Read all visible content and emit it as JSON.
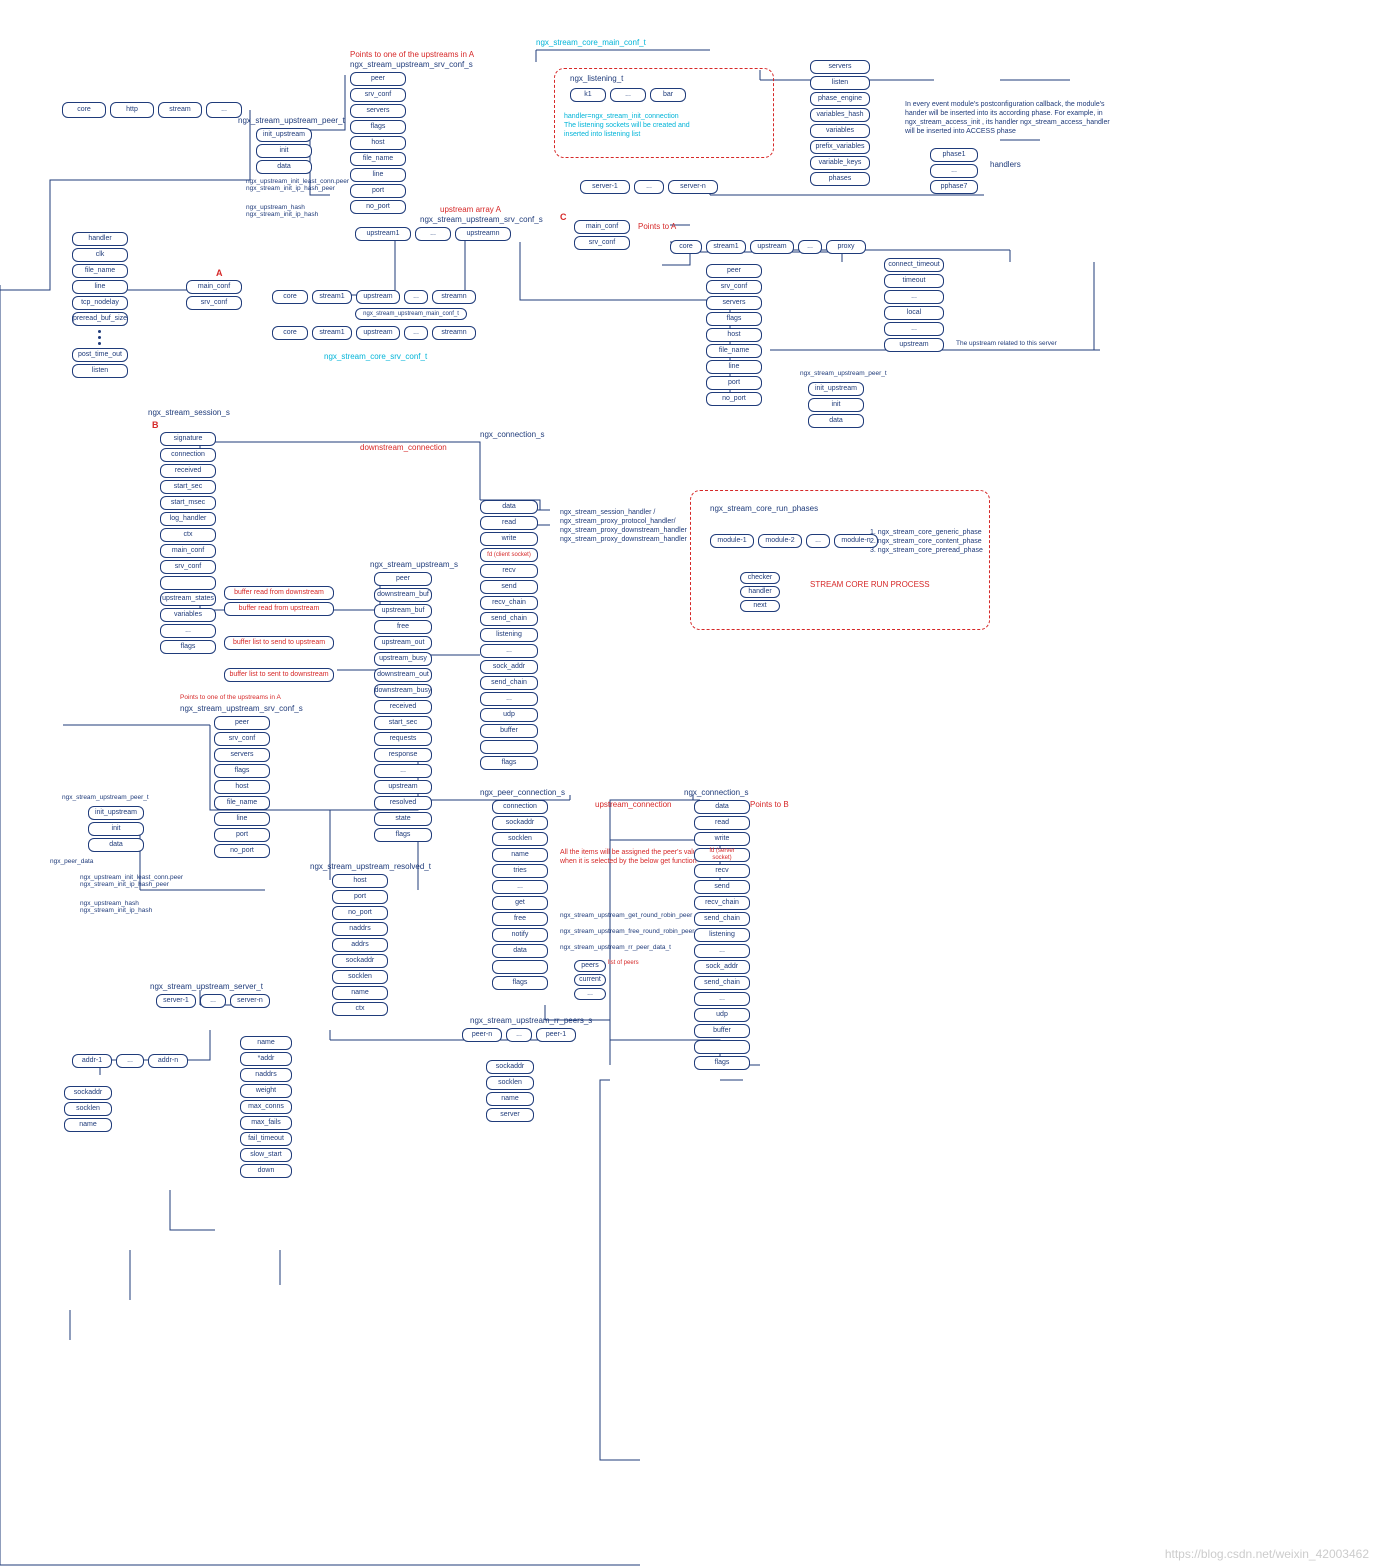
{
  "top_row": {
    "items": [
      "core",
      "http",
      "stream",
      "..."
    ]
  },
  "peer_t_1": {
    "title": "ngx_stream_upstream_peer_t",
    "items": [
      "init_upstream",
      "init",
      "data"
    ],
    "handlers_a": "ngx_upstream_init_least_conn.peer\nngx_stream_init_ip_hash_peer",
    "handlers_b": "ngx_upstream_hash\nngx_stream_init_ip_hash"
  },
  "upstream_srv_conf_1": {
    "red": "Points to one of the upstreams in A",
    "title": "ngx_stream_upstream_srv_conf_s",
    "items": [
      "peer",
      "srv_conf",
      "servers",
      "flags",
      "host",
      "file_name",
      "line",
      "port",
      "no_port"
    ]
  },
  "upstream_array": {
    "red": "upstream array A",
    "title": "ngx_stream_upstream_srv_conf_s",
    "items": [
      "upstream1",
      "...",
      "upstreamn"
    ]
  },
  "left_list": {
    "items": [
      "handler",
      "clk",
      "file_name",
      "line",
      "tcp_nodelay",
      "preread_buf_size",
      "",
      "",
      "post_time_out",
      "listen"
    ]
  },
  "marker_A": "A",
  "main_srv": {
    "items": [
      "main_conf",
      "srv_conf"
    ]
  },
  "main_rows": {
    "row1": [
      "core",
      "stream1",
      "upstream",
      "...",
      "streamn"
    ],
    "row2": [
      "core",
      "stream1",
      "upstream",
      "...",
      "streamn"
    ],
    "mid_label": "ngx_stream_upstream_main_conf_t",
    "bottom_label": "ngx_stream_core_srv_conf_t"
  },
  "top_label_cyan": "ngx_stream_core_main_conf_t",
  "listening": {
    "title": "ngx_listening_t",
    "items": [
      "k1",
      "...",
      "bar"
    ],
    "note": "handler=ngx_stream_init_connection\nThe listening sockets will be created and\ninserted into listening list"
  },
  "main_right": {
    "items": [
      "servers",
      "listen",
      "phase_engine",
      "variables_hash",
      "variables",
      "prefix_variables",
      "variable_keys",
      "phases"
    ]
  },
  "phase_note": "In every event module's postconfiguration callback, the module's\nhander will be inserted into its according phase. For example, in\nngx_stream_access_init , its handler ngx_stream_access_handler\nwill be inserted into ACCESS phase",
  "phases_box": {
    "items": [
      "phase1",
      "...",
      "pphase7"
    ],
    "label": "handlers"
  },
  "servers_row": {
    "items": [
      "server-1",
      "...",
      "server-n"
    ]
  },
  "marker_C": "C",
  "c_block": {
    "items": [
      "main_conf",
      "srv_conf"
    ],
    "points": "Points to A"
  },
  "c_row": {
    "items": [
      "core",
      "stream1",
      "upstream",
      "...",
      "proxy"
    ]
  },
  "upstream_srv_conf_2": {
    "items": [
      "peer",
      "srv_conf",
      "servers",
      "flags",
      "host",
      "file_name",
      "line",
      "port",
      "no_port"
    ]
  },
  "peer_t_2": {
    "title": "ngx_stream_upstream_peer_t",
    "items": [
      "init_upstream",
      "init",
      "data"
    ]
  },
  "proxy_list": {
    "items": [
      "connect_timeout",
      "timeout",
      "...",
      "local",
      "...",
      "upstream"
    ],
    "note": "The upstream related to this server"
  },
  "session": {
    "title": "ngx_stream_session_s",
    "marker": "B",
    "items": [
      "signature",
      "connection",
      "received",
      "start_sec",
      "start_msec",
      "log_handler",
      "ctx",
      "main_conf",
      "srv_conf",
      "",
      "upstream_states",
      "variables",
      "...",
      "flags"
    ]
  },
  "buff_notes": {
    "a": "buffer read from downstream",
    "b": "buffer read from upstream",
    "c": "buffer list to send to upstream",
    "d": "buffer list to sent to downstream"
  },
  "upstream_s": {
    "title": "ngx_stream_upstream_s",
    "items": [
      "peer",
      "downstream_buf",
      "upstream_buf",
      "free",
      "upstream_out",
      "upstream_busy",
      "downstream_out",
      "downstream_busy",
      "received",
      "start_sec",
      "requests",
      "response",
      "...",
      "upstream",
      "resolved",
      "state",
      "flags"
    ]
  },
  "connection_1": {
    "title": "ngx_connection_s",
    "red": "downstream_connection",
    "items": [
      "data",
      "read",
      "write",
      "fd (client socket)",
      "recv",
      "send",
      "recv_chain",
      "send_chain",
      "listening",
      "...",
      "sock_addr",
      "send_chain",
      "...",
      "udp",
      "buffer",
      "",
      "flags"
    ],
    "handlers": "ngx_stream_session_handler /\nngx_stream_proxy_protocol_handler/\nngx_stream_proxy_downstream_handler\nngx_stream_proxy_downstream_handler"
  },
  "core_run": {
    "title": "ngx_stream_core_run_phases",
    "modules": [
      "module-1",
      "module-2",
      "...",
      "module-n"
    ],
    "chain": [
      "checker",
      "handler",
      "next"
    ],
    "list": [
      "ngx_stream_core_generic_phase",
      "ngx_stream_core_content_phase",
      "ngx_stream_core_preread_phase"
    ],
    "heading": "STREAM CORE RUN PROCESS"
  },
  "upstream_srv_conf_3": {
    "red": "Points to one of the upstreams in A",
    "title": "ngx_stream_upstream_srv_conf_s",
    "items": [
      "peer",
      "srv_conf",
      "servers",
      "flags",
      "host",
      "file_name",
      "line",
      "port",
      "no_port"
    ]
  },
  "peer_t_3": {
    "title": "ngx_stream_upstream_peer_t",
    "items": [
      "init_upstream",
      "init",
      "data"
    ],
    "extra": "ngx_peer_data",
    "handlers_a": "ngx_upstream_init_least_conn.peer\nngx_stream_init_ip_hash_peer",
    "handlers_b": "ngx_upstream_hash\nngx_stream_init_ip_hash"
  },
  "resolved": {
    "title": "ngx_stream_upstream_resolved_t",
    "items": [
      "host",
      "port",
      "no_port",
      "naddrs",
      "addrs",
      "sockaddr",
      "socklen",
      "name",
      "ctx"
    ]
  },
  "peer_conn": {
    "title": "ngx_peer_connection_s",
    "red": "upstream_connection",
    "items": [
      "connection",
      "sockaddr",
      "socklen",
      "name",
      "tries",
      "...",
      "get",
      "free",
      "notify",
      "data",
      "",
      "flags"
    ],
    "note": "All the items will be assigned the peer's value\nwhen it is selected by the below get function",
    "handlers": {
      "get": "ngx_stream_upstream_get_round_robin_peer",
      "free": "ngx_stream_upstream_free_round_robin_peer",
      "notify": "ngx_stream_upstream_rr_peer_data_t"
    },
    "points": "Points to B",
    "peers_label": "list of peers",
    "peers": [
      "peers",
      "current",
      "..."
    ]
  },
  "connection_2": {
    "title": "ngx_connection_s",
    "items": [
      "data",
      "read",
      "write",
      "fd (server socket)",
      "recv",
      "send",
      "recv_chain",
      "send_chain",
      "listening",
      "...",
      "sock_addr",
      "send_chain",
      "...",
      "udp",
      "buffer",
      "",
      "flags"
    ]
  },
  "rr_peers": {
    "title": "ngx_stream_upstream_rr_peers_s",
    "items": [
      "peer-n",
      "...",
      "peer-1"
    ],
    "detail": [
      "sockaddr",
      "socklen",
      "name",
      "server"
    ]
  },
  "upstream_server": {
    "title": "ngx_stream_upstream_server_t",
    "row": [
      "server-1",
      "...",
      "server-n"
    ],
    "items": [
      "name",
      "*addr",
      "naddrs",
      "weight",
      "max_conns",
      "max_fails",
      "fail_timeout",
      "slow_start",
      "down"
    ]
  },
  "addr_row": {
    "items": [
      "addr-1",
      "...",
      "addr-n"
    ],
    "detail": [
      "sockaddr",
      "socklen",
      "name"
    ]
  },
  "watermark": "https://blog.csdn.net/weixin_42003462"
}
